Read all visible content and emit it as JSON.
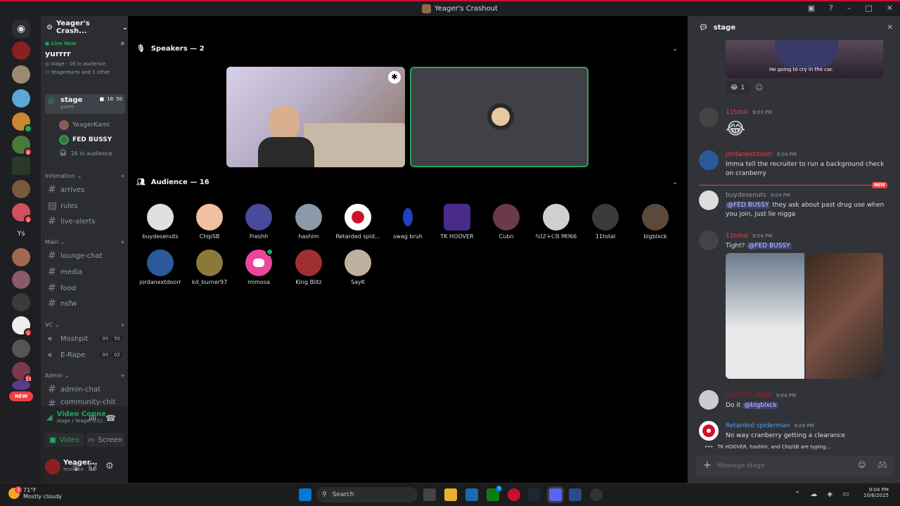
{
  "window": {
    "title": "Yeager's Crashout"
  },
  "server": {
    "name": "Yeager's Crash..."
  },
  "live": {
    "status": "Live Now",
    "title": "yurrrr",
    "stage_line": "stage · 16 in audience",
    "members_line": "YeagerKami and 1 other"
  },
  "channels": {
    "stage": {
      "name": "stage",
      "sub": "yurrrr",
      "count1": "18",
      "count2": "50"
    },
    "stage_members": [
      "YeagerKami",
      "FED BUSSY",
      "16 in audience"
    ],
    "categories": {
      "info": "Infomation",
      "main": "Main",
      "vc": "VC",
      "admin": "Admin"
    },
    "info_items": [
      "arrives",
      "rules",
      "live-alerts"
    ],
    "main_items": [
      "lounge-chat",
      "media",
      "food",
      "nsfw"
    ],
    "vc_items": [
      {
        "name": "Moshpit",
        "a": "00",
        "b": "50"
      },
      {
        "name": "E-Rape",
        "a": "00",
        "b": "02"
      }
    ],
    "admin_items": [
      "admin-chat",
      "community-chit"
    ]
  },
  "voice": {
    "status": "Video Connecte",
    "location": "stage / Yeager's Cr...",
    "video_label": "Video",
    "screen_label": "Screen"
  },
  "user": {
    "name": "Yeager...",
    "status": "Invisible"
  },
  "guild_badges": {
    "new": "NEW",
    "b1": "8",
    "b2": "3",
    "b3": "1",
    "b4": "12",
    "ys": "Ys"
  },
  "stage": {
    "speakers_label": "Speakers — 2",
    "audience_label": "Audience — 16",
    "audience": [
      "buydesenuts",
      "ChipSB",
      "Freshh",
      "hashim",
      "Retarded spid...",
      "swag bruh",
      "TK HOOVER",
      "Cubn",
      "ℕ𝕀ℤ∔ℂℝ ᏒᎧ66",
      "11total",
      "blgblxck",
      "jordanextdoorr",
      "kd_burner97",
      "mimosa",
      "King Blitz",
      "SayK"
    ]
  },
  "chat": {
    "channel": "stage",
    "caption": "He going to cry in the car.",
    "reaction_count": "1",
    "new_label": "NEW",
    "messages": [
      {
        "author": "11total",
        "time": "9:03 PM",
        "text": "😂"
      },
      {
        "author": "jordanextdoorr",
        "time": "9:04 PM",
        "text": "Imma tell the recruiter to run a background check on cranberry"
      },
      {
        "author": "buydesenuts",
        "time": "9:04 PM",
        "mention": "@FED BUSSY",
        "text": " they ask about past drug use when you join, just lie nigga"
      },
      {
        "author": "11total",
        "time": "9:04 PM",
        "text": "Tight? ",
        "mention": "@FED BUSSY"
      },
      {
        "author": "ℕ𝕀ℤ∔ℂℝ ᏒᎧ66",
        "time": "9:04 PM",
        "text": "Do it ",
        "mention": "@blgblxck"
      },
      {
        "author": "Retarded spiderman",
        "time": "9:04 PM",
        "text": "No way cranberry getting a clearance"
      }
    ],
    "typing": "TK HOOVER, hashim, and ChipSB are typing...",
    "placeholder": "Message stage"
  },
  "taskbar": {
    "temp": "71°F",
    "weather": "Mostly cloudy",
    "search": "Search",
    "time": "9:04 PM",
    "date": "10/6/2025",
    "weather_badge": "3",
    "xbox_badge": "3"
  }
}
